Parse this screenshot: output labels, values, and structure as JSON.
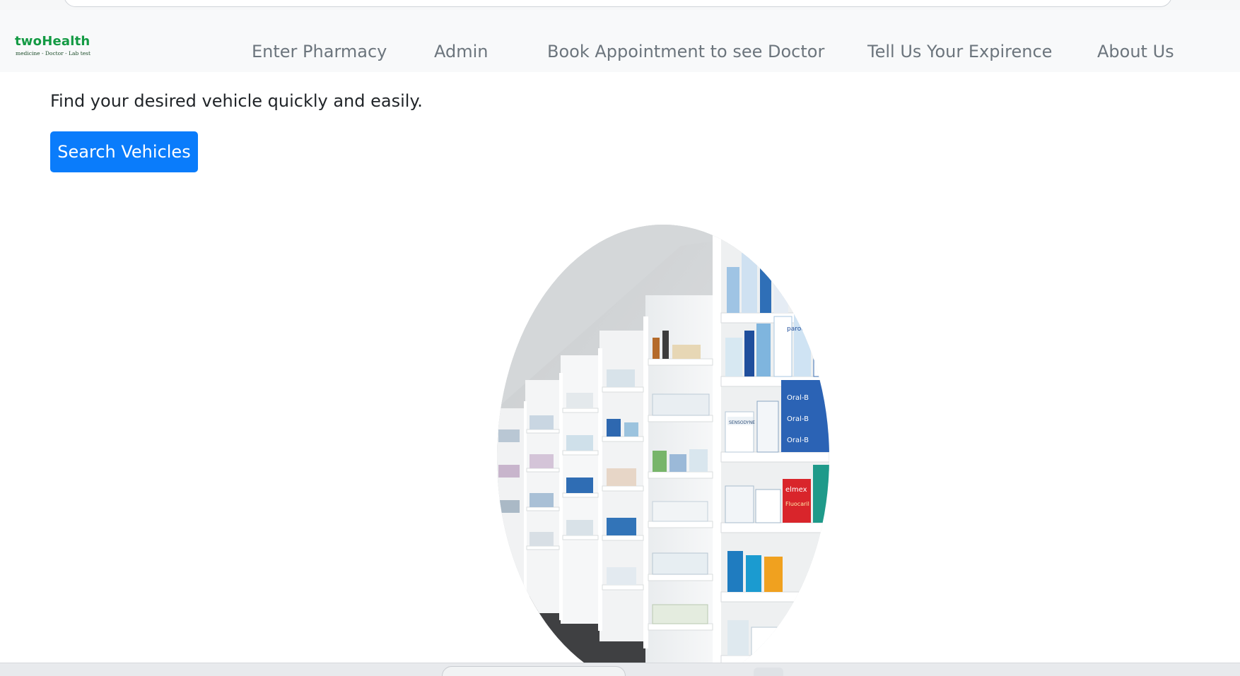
{
  "brand": {
    "name": "twoHealth",
    "tagline": "medicine -   Doctor -   Lab test",
    "color": "#139a43"
  },
  "nav": {
    "items": [
      {
        "label": "Enter Pharmacy"
      },
      {
        "label": "Admin"
      },
      {
        "label": "Book Appointment to see Doctor"
      },
      {
        "label": "Tell Us Your Expirence"
      },
      {
        "label": "About Us"
      }
    ],
    "link_color": "#6c757d"
  },
  "hero": {
    "lead_text": "Find your desired vehicle quickly and easily.",
    "button_label": "Search Vehicles",
    "button_color": "#0a7cfb",
    "image": "pharmacy-shelves-photo"
  },
  "shelf_labels": {
    "oral_b": "Oral-B",
    "elmex": "elmex",
    "fluocaril": "Fluocaril",
    "sensodyne": "SENSODYNE",
    "parodontax": "parodo"
  }
}
